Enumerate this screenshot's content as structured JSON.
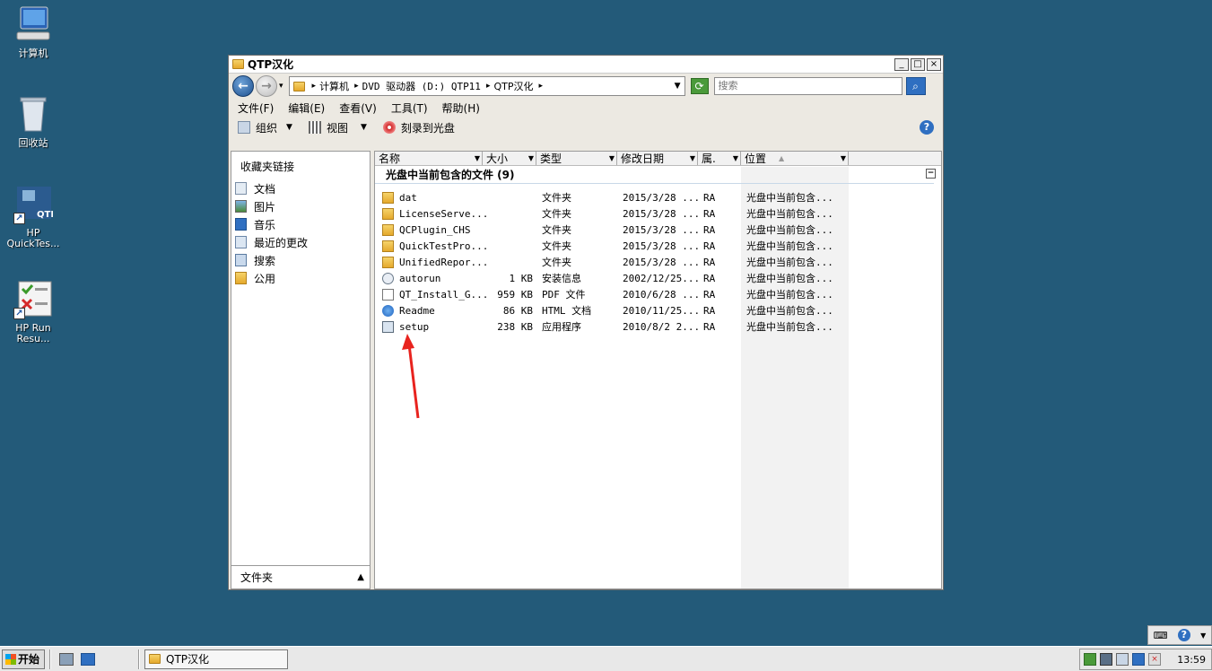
{
  "desktop": {
    "icons": [
      {
        "label": "计算机"
      },
      {
        "label": "回收站"
      },
      {
        "label": "HP QuickTes..."
      },
      {
        "label": "HP Run Resu..."
      }
    ]
  },
  "window": {
    "title": "QTP汉化",
    "controls": {
      "minimize": "_",
      "maximize": "□",
      "close": "×"
    },
    "address": {
      "crumbs": [
        "计算机",
        "DVD 驱动器 (D:) QTP11",
        "QTP汉化"
      ],
      "search_placeholder": "搜索"
    },
    "menu": [
      "文件(F)",
      "编辑(E)",
      "查看(V)",
      "工具(T)",
      "帮助(H)"
    ],
    "toolbar": {
      "organize": "组织",
      "views": "视图",
      "burn": "刻录到光盘",
      "help": "?"
    },
    "nav": {
      "heading": "收藏夹链接",
      "items": [
        "文档",
        "图片",
        "音乐",
        "最近的更改",
        "搜索",
        "公用"
      ],
      "footer": "文件夹"
    },
    "columns": [
      "名称",
      "大小",
      "类型",
      "修改日期",
      "属.",
      "位置"
    ],
    "group_header": "光盘中当前包含的文件 (9)",
    "files": [
      {
        "name": "dat",
        "size": "",
        "type": "文件夹",
        "date": "2015/3/28 ...",
        "attr": "RA",
        "location": "光盘中当前包含..."
      },
      {
        "name": "LicenseServe...",
        "size": "",
        "type": "文件夹",
        "date": "2015/3/28 ...",
        "attr": "RA",
        "location": "光盘中当前包含..."
      },
      {
        "name": "QCPlugin_CHS",
        "size": "",
        "type": "文件夹",
        "date": "2015/3/28 ...",
        "attr": "RA",
        "location": "光盘中当前包含..."
      },
      {
        "name": "QuickTestPro...",
        "size": "",
        "type": "文件夹",
        "date": "2015/3/28 ...",
        "attr": "RA",
        "location": "光盘中当前包含..."
      },
      {
        "name": "UnifiedRepor...",
        "size": "",
        "type": "文件夹",
        "date": "2015/3/28 ...",
        "attr": "RA",
        "location": "光盘中当前包含..."
      },
      {
        "name": "autorun",
        "size": "1 KB",
        "type": "安装信息",
        "date": "2002/12/25...",
        "attr": "RA",
        "location": "光盘中当前包含..."
      },
      {
        "name": "QT_Install_G...",
        "size": "959 KB",
        "type": "PDF 文件",
        "date": "2010/6/28 ...",
        "attr": "RA",
        "location": "光盘中当前包含..."
      },
      {
        "name": "Readme",
        "size": "86 KB",
        "type": "HTML 文档",
        "date": "2010/11/25...",
        "attr": "RA",
        "location": "光盘中当前包含..."
      },
      {
        "name": "setup",
        "size": "238 KB",
        "type": "应用程序",
        "date": "2010/8/2 2...",
        "attr": "RA",
        "location": "光盘中当前包含..."
      }
    ]
  },
  "taskbar": {
    "start": "开始",
    "task": "QTP汉化",
    "clock": "13:59"
  },
  "colors": {
    "desktop": "#235a79",
    "annotation_arrow": "#e8231e"
  }
}
